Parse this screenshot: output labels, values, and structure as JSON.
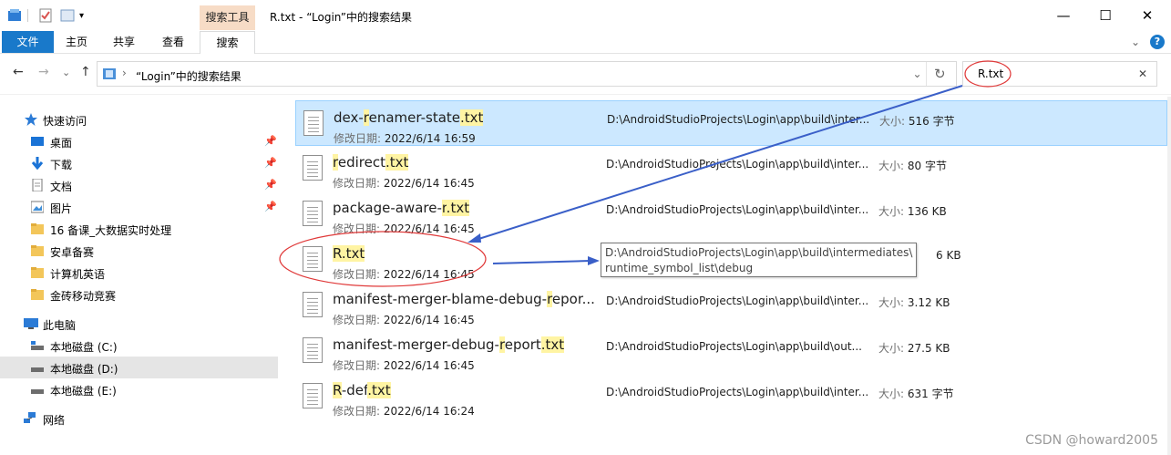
{
  "window": {
    "title": "R.txt - “Login”中的搜索结果",
    "contextual_tool": "搜索工具",
    "controls": {
      "minimize": "—",
      "maximize": "☐",
      "close": "✕"
    }
  },
  "ribbon": {
    "tabs": [
      "文件",
      "主页",
      "共享",
      "查看",
      "搜索"
    ],
    "expand_icon": "⌄",
    "help_icon": "?"
  },
  "nav": {
    "back": "←",
    "forward": "→",
    "history": "⌄",
    "up": "↑",
    "breadcrumb_sep": "›",
    "address": "“Login”中的搜索结果",
    "address_dropdown": "⌄",
    "refresh": "↻",
    "search_value": "R.txt",
    "search_clear": "✕"
  },
  "navpane": {
    "quick_access": "快速访问",
    "items": [
      {
        "label": "桌面",
        "pinned": true
      },
      {
        "label": "下载",
        "pinned": true
      },
      {
        "label": "文档",
        "pinned": true
      },
      {
        "label": "图片",
        "pinned": true
      },
      {
        "label": "16 备课_大数据实时处理",
        "pinned": false
      },
      {
        "label": "安卓备赛",
        "pinned": false
      },
      {
        "label": "计算机英语",
        "pinned": false
      },
      {
        "label": "金砖移动竞赛",
        "pinned": false
      }
    ],
    "this_pc": "此电脑",
    "drives": [
      "本地磁盘 (C:)",
      "本地磁盘 (D:)",
      "本地磁盘 (E:)"
    ],
    "network": "网络"
  },
  "results": {
    "date_label": "修改日期:",
    "size_label": "大小:",
    "items": [
      {
        "name_parts": [
          "dex-",
          "r",
          "enamer-state",
          ".txt"
        ],
        "date": "2022/6/14 16:59",
        "path": "D:\\AndroidStudioProjects\\Login\\app\\build\\inter...",
        "size": "516 字节"
      },
      {
        "name_parts": [
          "",
          "r",
          "edirect",
          ".txt"
        ],
        "date": "2022/6/14 16:45",
        "path": "D:\\AndroidStudioProjects\\Login\\app\\build\\inter...",
        "size": "80 字节"
      },
      {
        "name_parts": [
          "package-aware-",
          "r",
          "",
          ".txt"
        ],
        "date": "2022/6/14 16:45",
        "path": "D:\\AndroidStudioProjects\\Login\\app\\build\\inter...",
        "size": "136 KB"
      },
      {
        "name_parts": [
          "",
          "R",
          "",
          ".txt"
        ],
        "date": "2022/6/14 16:45",
        "path": "",
        "size": "6 KB"
      },
      {
        "name_parts": [
          "manifest-merger-blame-debug-",
          "r",
          "epor...",
          ""
        ],
        "date": "2022/6/14 16:45",
        "path": "D:\\AndroidStudioProjects\\Login\\app\\build\\inter...",
        "size": "3.12 KB"
      },
      {
        "name_parts": [
          "manifest-merger-debug-",
          "r",
          "eport",
          ".txt"
        ],
        "date": "2022/6/14 16:45",
        "path": "D:\\AndroidStudioProjects\\Login\\app\\build\\out...",
        "size": "27.5 KB"
      },
      {
        "name_parts": [
          "",
          "R",
          "-def",
          ".txt"
        ],
        "date": "2022/6/14 16:24",
        "path": "D:\\AndroidStudioProjects\\Login\\app\\build\\inter...",
        "size": "631 字节"
      }
    ]
  },
  "tooltip": {
    "line1": "D:\\AndroidStudioProjects\\Login\\app\\build\\intermediates\\",
    "line2": "runtime_symbol_list\\debug"
  },
  "watermark": "CSDN @howard2005",
  "colors": {
    "file_tab": "#1979ca",
    "highlight": "#fff4a3",
    "selection": "#cce8ff",
    "annotation_red": "#e03a3a",
    "annotation_blue": "#3a5fc8"
  }
}
